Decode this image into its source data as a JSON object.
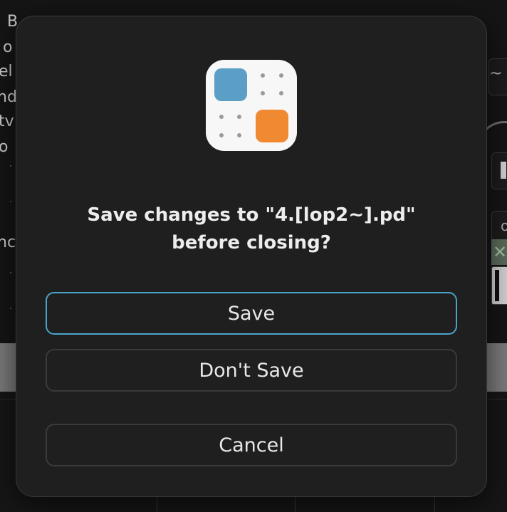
{
  "background": {
    "text_fragments": [
      "B",
      "o",
      "el",
      "nd",
      "tv",
      "o",
      "nc"
    ],
    "right_label": "~",
    "right_field_char": "o",
    "close_glyph": "✕"
  },
  "dialog": {
    "message_line1": "Save changes to \"4.[lop2~].pd\"",
    "message_line2": "before closing?",
    "buttons": {
      "save": "Save",
      "dont_save": "Don't Save",
      "cancel": "Cancel"
    }
  },
  "colors": {
    "accent": "#4aa3c9",
    "icon_blue": "#5b9ec6",
    "icon_orange": "#ef8a32"
  },
  "icons": {
    "app": "pure-data-app-icon"
  }
}
